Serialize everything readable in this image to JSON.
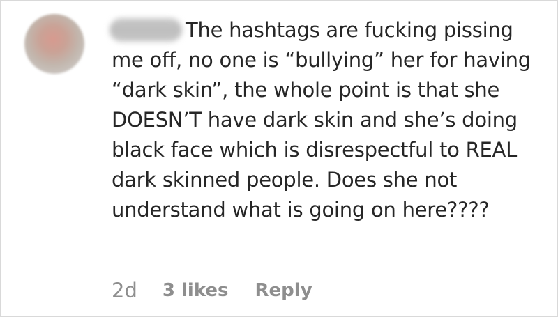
{
  "comment": {
    "text": "The hashtags are fucking pissing me off, no one is “bullying” her for having “dark skin”, the whole point is that she DOESN’T have dark skin and she’s doing black face which is disrespectful to REAL dark skinned people. Does she not understand what is going on here????"
  },
  "meta": {
    "time": "2d",
    "likes": "3 likes",
    "reply": "Reply"
  }
}
